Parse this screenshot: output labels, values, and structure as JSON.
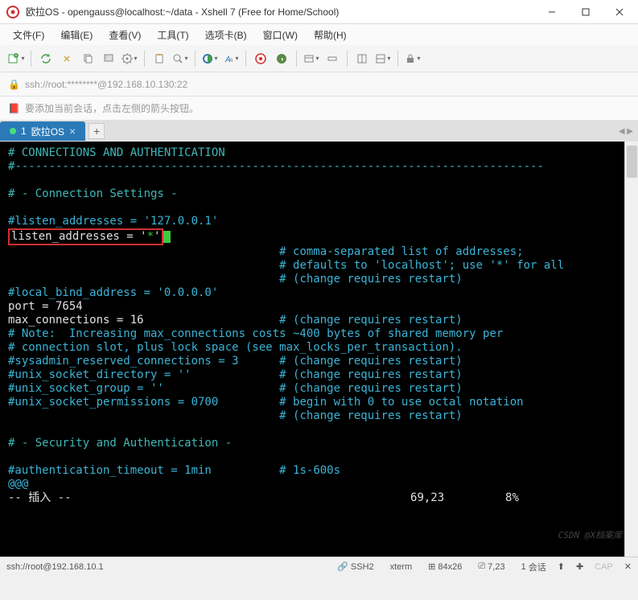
{
  "titlebar": {
    "title": "欧拉OS - opengauss@localhost:~/data - Xshell 7 (Free for Home/School)"
  },
  "menubar": {
    "file": "文件(F)",
    "edit": "编辑(E)",
    "view": "查看(V)",
    "tools": "工具(T)",
    "tab": "选项卡(B)",
    "window": "窗口(W)",
    "help": "帮助(H)"
  },
  "address": {
    "text": "ssh://root:********@192.168.10.130:22"
  },
  "infobar": {
    "text": "要添加当前会话，点击左侧的箭头按钮。"
  },
  "tab": {
    "index": "1",
    "title": "欧拉OS"
  },
  "terminal": {
    "header": "# CONNECTIONS AND AUTHENTICATION",
    "dashes": "#------------------------------------------------------------------------------",
    "section1": "# - Connection Settings -",
    "listen_comment": "#listen_addresses = '127.0.0.1'",
    "listen_active_key": "listen_addresses = '",
    "listen_active_val": "*",
    "listen_active_end": "'",
    "cmt1": "# comma-separated list of addresses;",
    "cmt2": "# defaults to 'localhost'; use '*' for all",
    "cmt3": "# (change requires restart)",
    "local_bind": "#local_bind_address = '0.0.0.0'",
    "port": "port = 7654",
    "maxconn": "max_connections = 16",
    "maxconn_cmt": "# (change requires restart)",
    "note1": "# Note:  Increasing max_connections costs ~400 bytes of shared memory per",
    "note2": "# connection slot, plus lock space (see max_locks_per_transaction).",
    "sysadmin": "#sysadmin_reserved_connections = 3",
    "sysadmin_cmt": "# (change requires restart)",
    "sockdir": "#unix_socket_directory = ''",
    "sockdir_cmt": "# (change requires restart)",
    "sockgrp": "#unix_socket_group = ''",
    "sockgrp_cmt": "# (change requires restart)",
    "sockperm": "#unix_socket_permissions = 0700",
    "sockperm_cmt": "# begin with 0 to use octal notation",
    "sockperm_cmt2": "# (change requires restart)",
    "section2": "# - Security and Authentication -",
    "authtime": "#authentication_timeout = 1min",
    "authtime_cmt": "# 1s-600s",
    "atmarks": "@@@",
    "insert": "-- 插入 --",
    "cursor_pos": "69,23",
    "percent": "8%",
    "watermark": "CSDN @X档案库"
  },
  "statusbar": {
    "path": "ssh://root@192.168.10.1",
    "ssh": "SSH2",
    "term": "xterm",
    "size": "84x26",
    "pos": "7,23",
    "sessions": "1",
    "sessions_label": "会话",
    "cap": "CAP",
    "nl": "↑"
  }
}
